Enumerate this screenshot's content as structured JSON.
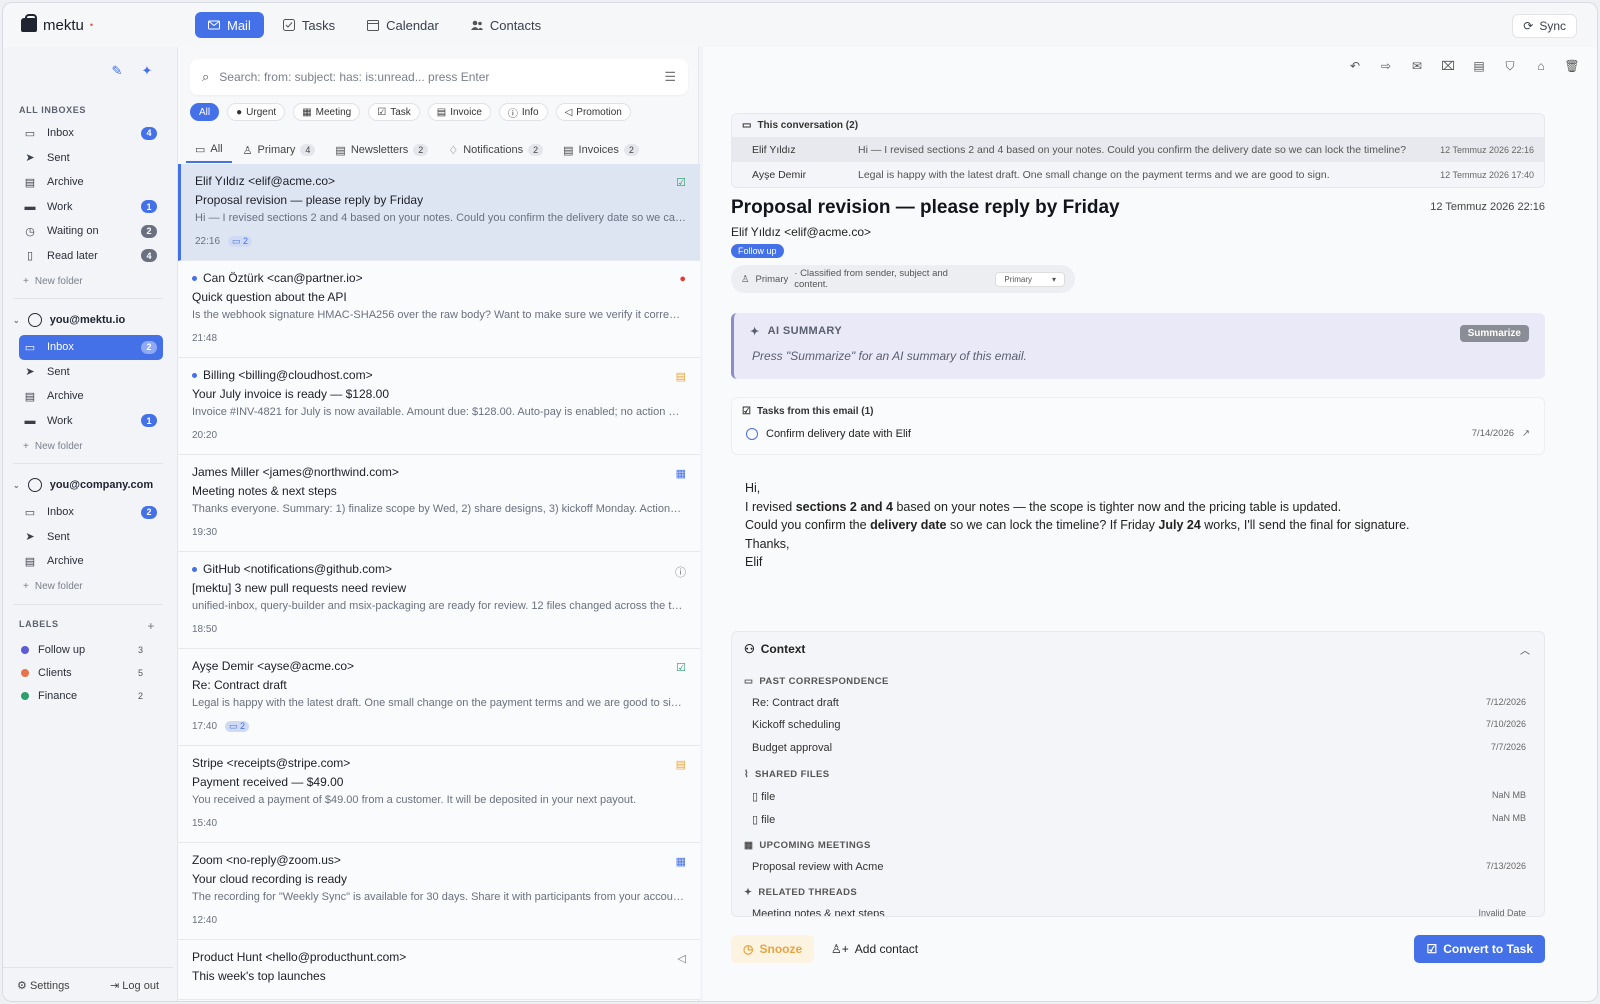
{
  "app": {
    "name": "mektu",
    "sup": "•"
  },
  "topnav": {
    "tabs": [
      {
        "label": "Mail"
      },
      {
        "label": "Tasks"
      },
      {
        "label": "Calendar"
      },
      {
        "label": "Contacts"
      }
    ],
    "sync": "Sync"
  },
  "sidebar": {
    "all_title": "ALL INBOXES",
    "all": [
      {
        "label": "Inbox",
        "count": "4"
      },
      {
        "label": "Sent"
      },
      {
        "label": "Archive"
      },
      {
        "label": "Work",
        "count": "1"
      },
      {
        "label": "Waiting on",
        "count": "2"
      },
      {
        "label": "Read later",
        "count": "4"
      }
    ],
    "new_folder": "New folder",
    "acc1": {
      "name": "you@mektu.io",
      "items": [
        {
          "label": "Inbox",
          "count": "2"
        },
        {
          "label": "Sent"
        },
        {
          "label": "Archive"
        },
        {
          "label": "Work",
          "count": "1"
        }
      ]
    },
    "acc2": {
      "name": "you@company.com",
      "items": [
        {
          "label": "Inbox",
          "count": "2"
        },
        {
          "label": "Sent"
        },
        {
          "label": "Archive"
        }
      ]
    },
    "labels_title": "LABELS",
    "labels": [
      {
        "label": "Follow up",
        "count": "3",
        "color": "#5b5bd6"
      },
      {
        "label": "Clients",
        "count": "5",
        "color": "#e8734a"
      },
      {
        "label": "Finance",
        "count": "2",
        "color": "#2e9e6b"
      }
    ],
    "settings": "Settings",
    "logout": "Log out"
  },
  "list": {
    "search_placeholder": "Search: from: subject: has: is:unread... press Enter",
    "chips": [
      "All",
      "Urgent",
      "Meeting",
      "Task",
      "Invoice",
      "Info",
      "Promotion"
    ],
    "tabs": [
      {
        "label": "All"
      },
      {
        "label": "Primary",
        "count": "4"
      },
      {
        "label": "Newsletters",
        "count": "2"
      },
      {
        "label": "Notifications",
        "count": "2"
      },
      {
        "label": "Invoices",
        "count": "2"
      }
    ],
    "messages": [
      {
        "from": "Elif Yıldız <elif@acme.co>",
        "subject": "Proposal revision — please reply by Friday",
        "preview": "Hi — I revised sections 2 and 4 based on your notes. Could you confirm the delivery date so we can lo...",
        "time": "22:16",
        "thread": "2"
      },
      {
        "from": "Can Öztürk <can@partner.io>",
        "subject": "Quick question about the API",
        "preview": "Is the webhook signature HMAC-SHA256 over the raw body? Want to make sure we verify it correctly ...",
        "time": "21:48"
      },
      {
        "from": "Billing <billing@cloudhost.com>",
        "subject": "Your July invoice is ready — $128.00",
        "preview": "Invoice #INV-4821 for July is now available. Amount due: $128.00. Auto-pay is enabled; no action nee...",
        "time": "20:20"
      },
      {
        "from": "James Miller <james@northwind.com>",
        "subject": "Meeting notes & next steps",
        "preview": "Thanks everyone. Summary: 1) finalize scope by Wed, 2) share designs, 3) kickoff Monday. Action ite...",
        "time": "19:30"
      },
      {
        "from": "GitHub <notifications@github.com>",
        "subject": "[mektu] 3 new pull requests need review",
        "preview": "unified-inbox, query-builder and msix-packaging are ready for review. 12 files changed across the thre...",
        "time": "18:50"
      },
      {
        "from": "Ayşe Demir <ayse@acme.co>",
        "subject": "Re: Contract draft",
        "preview": "Legal is happy with the latest draft. One small change on the payment terms and we are good to sign.",
        "time": "17:40",
        "thread": "2"
      },
      {
        "from": "Stripe <receipts@stripe.com>",
        "subject": "Payment received — $49.00",
        "preview": "You received a payment of $49.00 from a customer. It will be deposited in your next payout.",
        "time": "15:40"
      },
      {
        "from": "Zoom <no-reply@zoom.us>",
        "subject": "Your cloud recording is ready",
        "preview": "The recording for \"Weekly Sync\" is available for 30 days. Share it with participants from your account.",
        "time": "12:40"
      },
      {
        "from": "Product Hunt <hello@producthunt.com>",
        "subject": "This week's top launches",
        "preview": "",
        "time": ""
      }
    ]
  },
  "reader": {
    "conv_title": "This conversation (2)",
    "conv": [
      {
        "name": "Elif Yıldız",
        "text": "Hi — I revised sections 2 and 4 based on your notes. Could you confirm the delivery date so we can lock the timeline?",
        "date": "12 Temmuz 2026 22:16"
      },
      {
        "name": "Ayşe Demir",
        "text": "Legal is happy with the latest draft. One small change on the payment terms and we are good to sign.",
        "date": "12 Temmuz 2026 17:40"
      }
    ],
    "title": "Proposal revision — please reply by Friday",
    "date": "12 Temmuz 2026 22:16",
    "from": "Elif Yıldız <elif@acme.co>",
    "tag": "Follow up",
    "classif_label": "Primary",
    "classif_text": "· Classified from sender, subject and content.",
    "classif_select": "Primary",
    "ai_title": "AI SUMMARY",
    "ai_text": "Press \"Summarize\" for an AI summary of this email.",
    "ai_button": "Summarize",
    "tasks_title": "Tasks from this email (1)",
    "task": "Confirm delivery date with Elif",
    "task_date": "7/14/2026",
    "body": {
      "greeting": "Hi,",
      "l1a": "I revised ",
      "l1b": "sections 2 and 4",
      "l1c": " based on your notes — the scope is tighter now and the pricing table is updated.",
      "l2a": "Could you confirm the ",
      "l2b": "delivery date",
      "l2c": " so we can lock the timeline? If Friday ",
      "l2d": "July 24",
      "l2e": " works, I'll send the final for signature.",
      "thanks": "Thanks,",
      "sign": "Elif"
    },
    "context_title": "Context",
    "past_title": "PAST CORRESPONDENCE",
    "past": [
      {
        "label": "Re: Contract draft",
        "date": "7/12/2026"
      },
      {
        "label": "Kickoff scheduling",
        "date": "7/10/2026"
      },
      {
        "label": "Budget approval",
        "date": "7/7/2026"
      }
    ],
    "files_title": "SHARED FILES",
    "files": [
      {
        "label": "file",
        "size": "NaN MB"
      },
      {
        "label": "file",
        "size": "NaN MB"
      }
    ],
    "meet_title": "UPCOMING MEETINGS",
    "meet": [
      {
        "label": "Proposal review with Acme",
        "date": "7/13/2026"
      }
    ],
    "related_title": "RELATED THREADS",
    "related": [
      {
        "label": "Meeting notes & next steps",
        "date": "Invalid Date"
      }
    ],
    "snooze": "Snooze",
    "add_contact": "Add contact",
    "convert": "Convert to Task"
  }
}
